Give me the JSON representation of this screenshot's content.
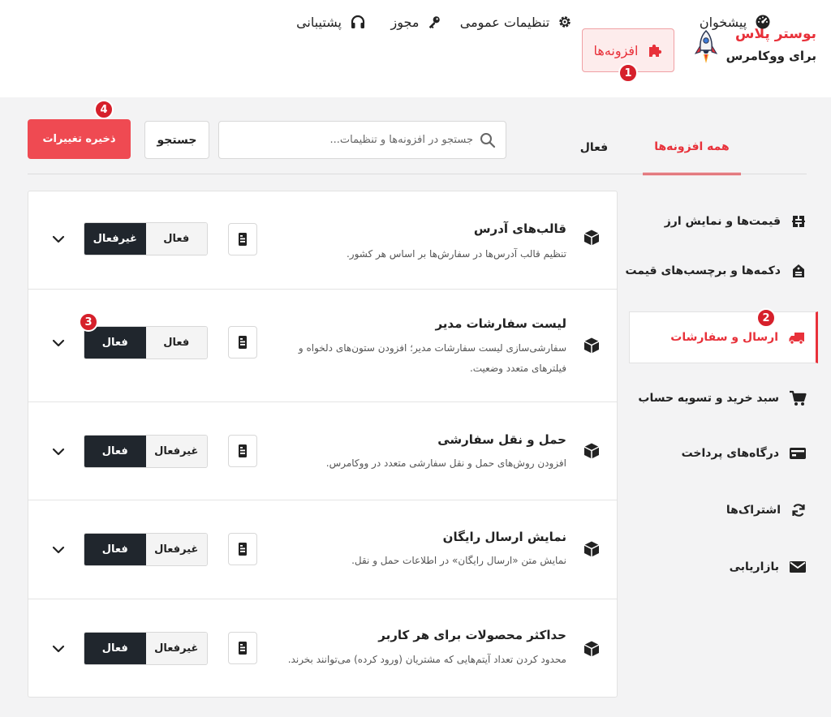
{
  "brand": {
    "title": "بوستر پلاس",
    "subtitle": "برای ووکامرس"
  },
  "nav": {
    "dashboard": "پیشخوان",
    "addons": "افزونه‌ها",
    "general_settings": "تنظیمات عمومی",
    "license": "مجوز",
    "support": "پشتیبانی"
  },
  "badges": {
    "b1": "1",
    "b2": "2",
    "b3": "3",
    "b4": "4"
  },
  "tabs": {
    "all": "همه افزونه‌ها",
    "active": "فعال"
  },
  "search": {
    "placeholder": "جستجو در افزونه‌ها و تنظیمات...",
    "button": "جستجو"
  },
  "save_button": "ذخیره تغییرات",
  "sidebar": {
    "items": [
      {
        "label": "قیمت‌ها و نمایش ارز"
      },
      {
        "label": "دکمه‌ها و برچسب‌های قیمت"
      },
      {
        "label": "ارسال و سفارشات"
      },
      {
        "label": "سبد خرید و تسویه حساب"
      },
      {
        "label": "درگاه‌های پرداخت"
      },
      {
        "label": "اشتراک‌ها"
      },
      {
        "label": "بازاریابی"
      }
    ]
  },
  "rows": [
    {
      "title": "قالب‌های آدرس",
      "desc1": "تنظیم قالب آدرس‌ها در سفارش‌ها بر اساس هر کشور.",
      "desc2": "",
      "left_label": "غیرفعال",
      "right_label": "فعال"
    },
    {
      "title": "لیست سفارشات مدیر",
      "desc1": "سفارشی‌سازی لیست سفارشات مدیر؛ افزودن ستون‌های دلخواه و",
      "desc2": "فیلترهای متعدد وضعیت.",
      "left_label": "فعال",
      "right_label": "فعال"
    },
    {
      "title": "حمل و نقل سفارشی",
      "desc1": "افزودن روش‌های حمل و نقل سفارشی متعدد در ووکامرس.",
      "desc2": "",
      "left_label": "فعال",
      "right_label": "غیرفعال"
    },
    {
      "title": "نمایش ارسال رایگان",
      "desc1": "نمایش متن «ارسال رایگان» در اطلاعات حمل و نقل.",
      "desc2": "",
      "left_label": "فعال",
      "right_label": "غیرفعال"
    },
    {
      "title": "حداکثر محصولات برای هر کاربر",
      "desc1": "محدود کردن تعداد آیتم‌هایی که مشتریان (ورود کرده) می‌توانند بخرند.",
      "desc2": "",
      "left_label": "فعال",
      "right_label": "غیرفعال"
    }
  ],
  "colors": {
    "accent": "#e8313a",
    "dark": "#20262d",
    "save": "#ef4a52"
  }
}
